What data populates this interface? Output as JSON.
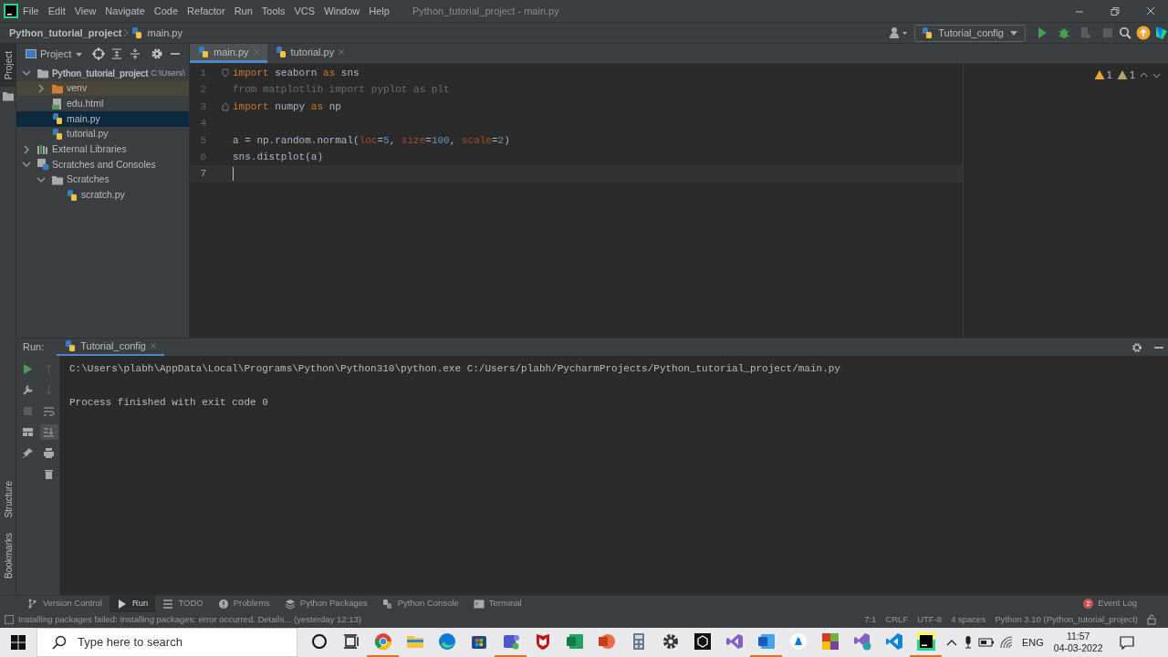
{
  "window": {
    "title": "Python_tutorial_project - main.py"
  },
  "menu": [
    "File",
    "Edit",
    "View",
    "Navigate",
    "Code",
    "Refactor",
    "Run",
    "Tools",
    "VCS",
    "Window",
    "Help"
  ],
  "breadcrumb": {
    "project": "Python_tutorial_project",
    "file": "main.py"
  },
  "run_config": "Tutorial_config",
  "toolbar_actions": [
    {
      "kind": "run",
      "disabled": false
    },
    {
      "kind": "debug",
      "disabled": false
    },
    {
      "kind": "coverage",
      "disabled": true
    },
    {
      "kind": "stop",
      "disabled": true
    }
  ],
  "side_stripe": [
    {
      "label": "Project",
      "selected": true
    },
    {
      "label": "Structure",
      "selected": false
    },
    {
      "label": "Bookmarks",
      "selected": false
    }
  ],
  "project_panel": {
    "title": "Project",
    "tree": [
      {
        "label": "Python_tutorial_project",
        "kind": "project",
        "hint": "C:\\Users\\",
        "expanded": true,
        "selected": false,
        "children": [
          {
            "label": "venv",
            "kind": "excluded-folder",
            "expanded": false,
            "selected": false
          },
          {
            "label": "edu.html",
            "kind": "html",
            "selected": false
          },
          {
            "label": "main.py",
            "kind": "python",
            "selected": true
          },
          {
            "label": "tutorial.py",
            "kind": "python",
            "selected": false
          }
        ]
      },
      {
        "label": "External Libraries",
        "kind": "libraries",
        "expanded": false,
        "selected": false
      },
      {
        "label": "Scratches and Consoles",
        "kind": "scratches",
        "expanded": true,
        "selected": false,
        "children": [
          {
            "label": "Scratches",
            "kind": "folder",
            "expanded": true,
            "selected": false,
            "children": [
              {
                "label": "scratch.py",
                "kind": "python",
                "selected": false
              }
            ]
          }
        ]
      }
    ]
  },
  "editor": {
    "tabs": [
      {
        "label": "main.py",
        "selected": true
      },
      {
        "label": "tutorial.py",
        "selected": false
      }
    ],
    "inspections": [
      {
        "kind": "warning",
        "count": "1"
      },
      {
        "kind": "weak-warning",
        "count": "1"
      }
    ],
    "lines": [
      {
        "number": "1",
        "current": false,
        "fold_start": true,
        "tokens": [
          {
            "text": "import",
            "kind": "keyword"
          },
          {
            "text": " seaborn ",
            "kind": "plain"
          },
          {
            "text": "as",
            "kind": "keyword"
          },
          {
            "text": " sns",
            "kind": "plain"
          }
        ]
      },
      {
        "number": "2",
        "current": false,
        "tokens": [
          {
            "text": "from matplotlib import pyplot as plt",
            "kind": "unused"
          }
        ]
      },
      {
        "number": "3",
        "current": false,
        "fold_end": true,
        "tokens": [
          {
            "text": "import",
            "kind": "keyword"
          },
          {
            "text": " numpy ",
            "kind": "plain"
          },
          {
            "text": "as",
            "kind": "keyword"
          },
          {
            "text": " np",
            "kind": "plain"
          }
        ]
      },
      {
        "number": "4",
        "current": false
      },
      {
        "number": "5",
        "current": false,
        "tokens": [
          {
            "text": "a = np.random.normal(",
            "kind": "plain"
          },
          {
            "text": "loc",
            "kind": "param"
          },
          {
            "text": "=",
            "kind": "plain"
          },
          {
            "text": "5",
            "kind": "number"
          },
          {
            "text": ", ",
            "kind": "plain"
          },
          {
            "text": "size",
            "kind": "param"
          },
          {
            "text": "=",
            "kind": "plain"
          },
          {
            "text": "100",
            "kind": "number"
          },
          {
            "text": ", ",
            "kind": "plain"
          },
          {
            "text": "scale",
            "kind": "param"
          },
          {
            "text": "=",
            "kind": "plain"
          },
          {
            "text": "2",
            "kind": "number"
          },
          {
            "text": ")",
            "kind": "plain"
          }
        ]
      },
      {
        "number": "6",
        "current": false,
        "tokens": [
          {
            "text": "sns.distplot(a)",
            "kind": "plain"
          }
        ]
      },
      {
        "number": "7",
        "current": true
      }
    ]
  },
  "run_panel": {
    "label": "Run:",
    "tabs": [
      {
        "label": "Tutorial_config",
        "selected": true
      }
    ],
    "output": [
      "C:\\Users\\plabh\\AppData\\Local\\Programs\\Python\\Python310\\python.exe C:/Users/plabh/PycharmProjects/Python_tutorial_project/main.py",
      "Process finished with exit code 0"
    ]
  },
  "tool_windows": [
    {
      "label": "Version Control",
      "kind": "vcs",
      "selected": false
    },
    {
      "label": "Run",
      "kind": "run",
      "selected": true
    },
    {
      "label": "TODO",
      "kind": "todo",
      "selected": false
    },
    {
      "label": "Problems",
      "kind": "problems",
      "selected": false
    },
    {
      "label": "Python Packages",
      "kind": "packages",
      "selected": false
    },
    {
      "label": "Python Console",
      "kind": "console",
      "selected": false
    },
    {
      "label": "Terminal",
      "kind": "terminal",
      "selected": false
    }
  ],
  "event_log": {
    "label": "Event Log",
    "count": "2"
  },
  "status_bar": {
    "message": "Installing packages failed: Installing packages: error occurred. Details... (yesterday 12:13)",
    "items": [
      "7:1",
      "CRLF",
      "UTF-8",
      "4 spaces",
      "Python 3.10 (Python_tutorial_project)"
    ]
  },
  "taskbar": {
    "search_placeholder": "Type here to search",
    "language": "ENG",
    "time": "11:57",
    "date": "04-03-2022",
    "apps": [
      {
        "kind": "chrome",
        "running": true
      },
      {
        "kind": "explorer",
        "running": false
      },
      {
        "kind": "edge",
        "running": false
      },
      {
        "kind": "store",
        "running": false
      },
      {
        "kind": "teams",
        "running": true
      },
      {
        "kind": "mcafee",
        "running": false
      },
      {
        "kind": "excel",
        "running": false
      },
      {
        "kind": "powerpoint",
        "running": false
      },
      {
        "kind": "calculator",
        "running": false
      },
      {
        "kind": "settings",
        "running": false
      },
      {
        "kind": "unity",
        "running": false
      },
      {
        "kind": "visualstudio",
        "running": false
      },
      {
        "kind": "word",
        "running": true
      },
      {
        "kind": "ai",
        "running": false
      },
      {
        "kind": "squares",
        "running": false
      },
      {
        "kind": "installer",
        "running": false
      },
      {
        "kind": "vscode",
        "running": false
      },
      {
        "kind": "pycharm",
        "running": true
      }
    ]
  }
}
